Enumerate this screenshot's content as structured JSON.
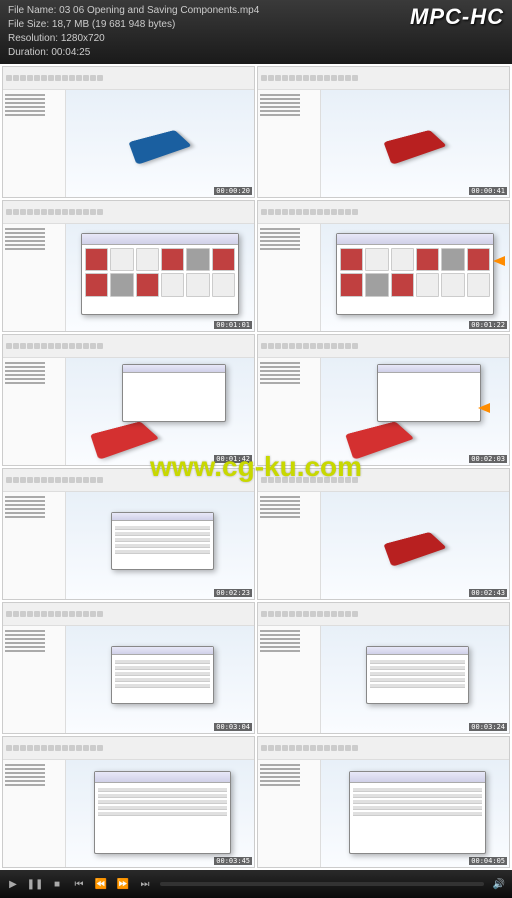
{
  "header": {
    "filename_label": "File Name:",
    "filename": "03 06 Opening and Saving Components.mp4",
    "filesize_label": "File Size:",
    "filesize": "18,7 MB (19 681 948 bytes)",
    "resolution_label": "Resolution:",
    "resolution": "1280x720",
    "duration_label": "Duration:",
    "duration": "00:04:25"
  },
  "logo": "MPC-HC",
  "watermark": "www.cg-ku.com",
  "thumbnails": [
    {
      "timestamp": "00:00:20",
      "type": "device-blue"
    },
    {
      "timestamp": "00:00:41",
      "type": "device-red"
    },
    {
      "timestamp": "00:01:01",
      "type": "grid"
    },
    {
      "timestamp": "00:01:22",
      "type": "grid-arrow"
    },
    {
      "timestamp": "00:01:42",
      "type": "red-dialog"
    },
    {
      "timestamp": "00:02:03",
      "type": "red-dialog-arrow"
    },
    {
      "timestamp": "00:02:23",
      "type": "table-dialog"
    },
    {
      "timestamp": "00:02:43",
      "type": "device-red-blue"
    },
    {
      "timestamp": "00:03:04",
      "type": "center-dialog"
    },
    {
      "timestamp": "00:03:24",
      "type": "center-dialog"
    },
    {
      "timestamp": "00:03:45",
      "type": "save-dialog"
    },
    {
      "timestamp": "00:04:05",
      "type": "save-dialog"
    }
  ]
}
